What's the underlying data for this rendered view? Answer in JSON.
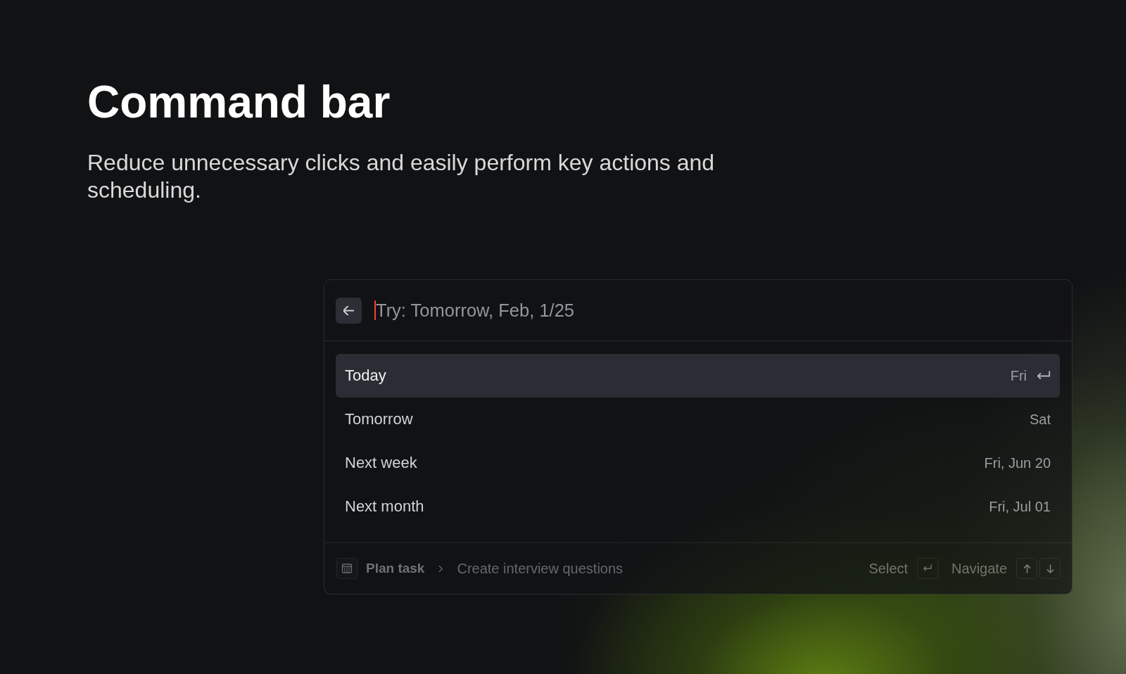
{
  "heading": {
    "title": "Command bar",
    "description": "Reduce unnecessary clicks and easily perform key actions and scheduling."
  },
  "command_bar": {
    "search": {
      "placeholder": "Try: Tomorrow, Feb, 1/25",
      "focused": true
    },
    "options": [
      {
        "label": "Today",
        "date": "Fri",
        "selected": true
      },
      {
        "label": "Tomorrow",
        "date": "Sat",
        "selected": false
      },
      {
        "label": "Next week",
        "date": "Fri, Jun 20",
        "selected": false
      },
      {
        "label": "Next month",
        "date": "Fri, Jul 01",
        "selected": false
      }
    ],
    "footer": {
      "context": "Plan task",
      "task": "Create interview questions",
      "hints": [
        {
          "label": "Select",
          "kind": "select"
        },
        {
          "label": "Navigate",
          "kind": "navigate"
        }
      ]
    }
  }
}
